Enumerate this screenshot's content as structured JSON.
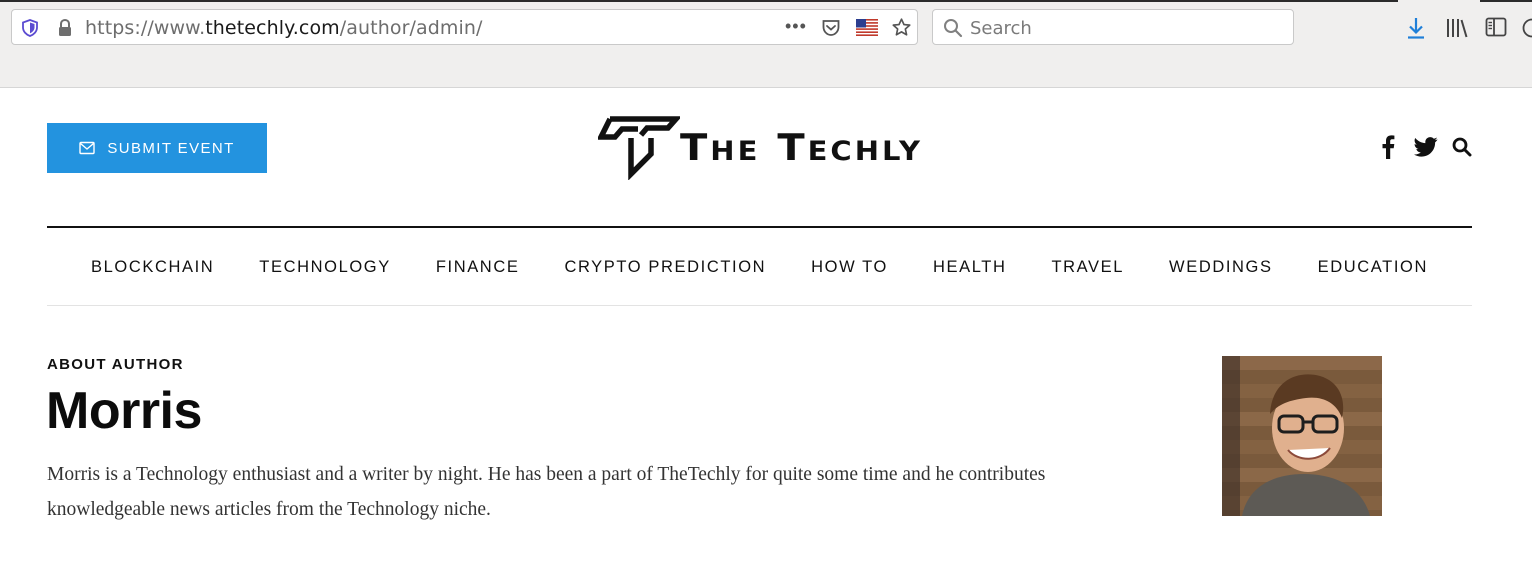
{
  "browser": {
    "url": {
      "scheme": "https://www.",
      "host": "thetechly.com",
      "path": "/author/admin/"
    },
    "more_glyph": "•••",
    "search_placeholder": "Search",
    "icons": [
      "shield-icon",
      "lock-icon",
      "pocket-icon",
      "us-flag-icon",
      "bookmark-star-icon",
      "search-icon",
      "download-icon",
      "library-icon",
      "sidebar-icon"
    ]
  },
  "site": {
    "submit_button_label": "SUBMIT EVENT",
    "logo_text": "The Techly",
    "nav": [
      "BLOCKCHAIN",
      "TECHNOLOGY",
      "FINANCE",
      "CRYPTO PREDICTION",
      "HOW TO",
      "HEALTH",
      "TRAVEL",
      "WEDDINGS",
      "EDUCATION"
    ],
    "social_icons": [
      "facebook-icon",
      "twitter-icon",
      "search-icon"
    ],
    "accent_color": "#2393df"
  },
  "author": {
    "label": "ABOUT AUTHOR",
    "name": "Morris",
    "bio": "Morris is a Technology enthusiast and a writer by night. He has been a part of TheTechly for quite some time and he contributes knowledgeable news articles from the Technology niche."
  }
}
